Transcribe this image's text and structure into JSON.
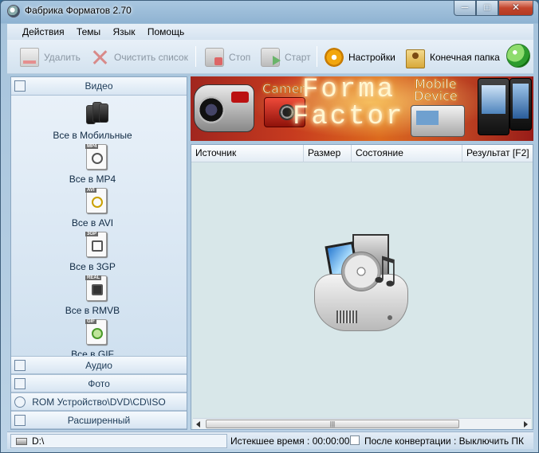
{
  "window": {
    "title": "Фабрика Форматов 2.70",
    "min": "─",
    "max": "□",
    "close": "✕"
  },
  "menu": [
    "Действия",
    "Темы",
    "Язык",
    "Помощь"
  ],
  "toolbar": {
    "delete": "Удалить",
    "clear": "Очистить список",
    "stop": "Стоп",
    "start": "Старт",
    "settings": "Настройки",
    "output_folder": "Конечная папка"
  },
  "sidebar": {
    "video_header": "Видео",
    "video_items": [
      {
        "label": "Все в Мобильные",
        "tag": ""
      },
      {
        "label": "Все в MP4",
        "tag": "MP4"
      },
      {
        "label": "Все в AVI",
        "tag": "AVI"
      },
      {
        "label": "Все в 3GP",
        "tag": "3GP"
      },
      {
        "label": "Все в RMVB",
        "tag": "REAL"
      },
      {
        "label": "Все в GIF",
        "tag": "GIF"
      }
    ],
    "audio_header": "Аудио",
    "photo_header": "Фото",
    "rom_header": "ROM Устройство\\DVD\\CD\\ISO",
    "advanced_header": "Расширенный"
  },
  "banner": {
    "camera": "Camer",
    "forma": "Forma",
    "factor": "Factor",
    "mobile": "Mobile",
    "device": "Device"
  },
  "file_list": {
    "columns": [
      "Источник",
      "Размер",
      "Состояние",
      "Результат [F2]"
    ],
    "rows": []
  },
  "scrollbar_grip": "|||",
  "status": {
    "path": "D:\\",
    "elapsed_label": "Истекшее время : 00:00:00",
    "after_conversion": "После конвертации : Выключить ПК"
  }
}
